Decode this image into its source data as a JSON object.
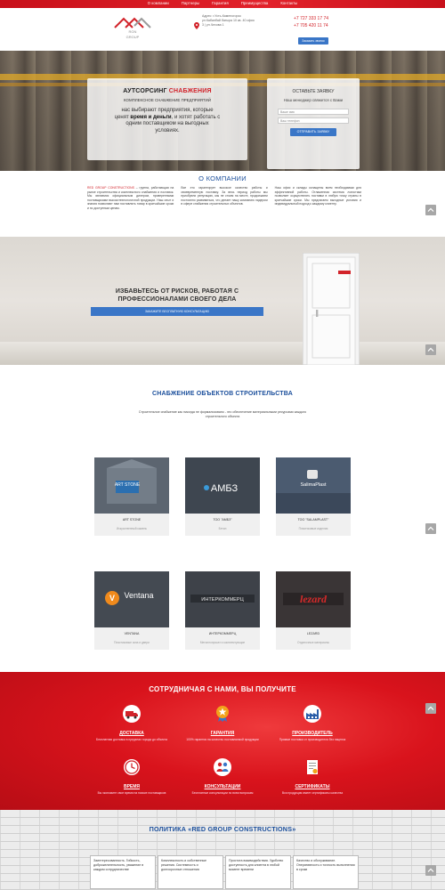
{
  "nav": {
    "items": [
      "О компании",
      "Партнеры",
      "Гарантия",
      "Преимущества",
      "Контакты"
    ]
  },
  "header": {
    "logo_text": "RGN\nGROUP",
    "address": "Адрес: г.Усть-Каменогорск ул.Кабанбай батыра 10 кв. 40 офис 3 | ул.Чехова 1",
    "phones": [
      "+7 727 333 17 74",
      "+7 705 420 11 74"
    ],
    "cta": "Заказать звонок"
  },
  "hero": {
    "title_main": "АУТСОРСИНГ ",
    "title_accent": "СНАБЖЕНИЯ",
    "subtitle": "КОМПЛЕКСНОЕ СНАБЖЕНИЕ ПРЕДПРИЯТИЙ",
    "text_a": "нас выбирают предприятия, которые ценят ",
    "text_b": "время и деньги",
    "text_c": ", и хотят работать с одним поставщиком на выгодных условиях.",
    "form": {
      "title": "ОСТАВЬТЕ ЗАЯВКУ",
      "subtitle": "Наш менеджер свяжется с Вами",
      "name_placeholder": "Ваше имя",
      "phone_placeholder": "Ваш телефон",
      "submit": "ОТПРАВИТЬ ЗАЯВКУ"
    }
  },
  "about": {
    "title": "О КОМПАНИИ",
    "col1_accent": "RED GROUP CONSTRUCTIONS",
    "col1": " – группа, работающая на рынке строительства и комплексного снабжения и поставок. Мы являемся официальным дилером, проверенными поставщиками высокотехнологичной продукции. Наш опыт и знания позволяют нам поставлять товар в кратчайшие сроки и по доступным ценам.",
    "col2": "Все это гарантирует высокое качество работы и своевременную поставку. За весь период работы мы приобрели репутацию, мы не стоим на месте, продолжаем постоянно развиваться, что делает нашу компанию лидером в сфере снабжения строительных объектов.",
    "col3": "Наш офис и склады оснащены всем необходимым для эффективной работы. Отлаженная система логистики позволяет осуществлять поставки в любую точку страны в кратчайшие сроки. Мы предлагаем выгодные условия и индивидуальный подход к каждому клиенту."
  },
  "banner": {
    "title": "ИЗБАВЬТЕСЬ ОТ РИСКОВ, РАБОТАЯ С ПРОФЕССИОНАЛАМИ СВОЕГО ДЕЛА",
    "button": "ЗАКАЖИТЕ БЕСПЛАТНУЮ КОНСУЛЬТАЦИЮ"
  },
  "supply": {
    "title": "СНАБЖЕНИЕ ОБЪЕКТОВ СТРОИТЕЛЬСТВА",
    "description": "Строительное снабжение как никогда не формализовано - это обеспечение материальными ресурсами каждого строительного объекта",
    "cards": [
      {
        "name": "ART STONE",
        "category": "Искусственный камень",
        "logo": "ART STONE"
      },
      {
        "name": "ТОО \"АМБЗ\"",
        "category": "Бетон",
        "logo": "АМБЗ"
      },
      {
        "name": "ТОО \"SALAMPLAST\"",
        "category": "Пластиковые изделия",
        "logo": "SalimaPlast"
      },
      {
        "name": "VENTANA",
        "category": "Пластиковые окна и двери",
        "logo": "Ventana"
      },
      {
        "name": "ИНТЕРКОММЕРЦ",
        "category": "Металлопрокат и комплектующие",
        "logo": "ИНТЕРКОММЕРЦ"
      },
      {
        "name": "LEZARD",
        "category": "Отделочные материалы",
        "logo": "lezard"
      }
    ]
  },
  "coop": {
    "title": "СОТРУДНИЧАЯ С НАМИ, ВЫ ПОЛУЧИТЕ",
    "features": [
      {
        "title": "ДОСТАВКА",
        "desc": "Бесплатная доставка в пределах города до объекта",
        "icon": "truck-icon"
      },
      {
        "title": "ГАРАНТИЯ",
        "desc": "100% гарантия на качество поставляемой продукции",
        "icon": "medal-icon"
      },
      {
        "title": "ПРОИЗВОДИТЕЛЬ",
        "desc": "Прямые поставки от производителя без наценок",
        "icon": "factory-icon"
      },
      {
        "title": "ВРЕМЯ",
        "desc": "Вы экономите свое время на поиске поставщиков",
        "icon": "clock-icon"
      },
      {
        "title": "КОНСУЛЬТАЦИИ",
        "desc": "Бесплатные консультации по всем вопросам",
        "icon": "people-icon"
      },
      {
        "title": "СЕРТИФИКАТЫ",
        "desc": "Вся продукция имеет сертификаты качества",
        "icon": "certificate-icon"
      }
    ]
  },
  "policy": {
    "title": "ПОЛИТИКА «RED GROUP CONSTRUCTIONS»",
    "items": [
      "Заинтересованность. Гибкость, доброжелательность, уважение в каждом сотрудничестве",
      "Комплексность и собственные решения. Системность и долгосрочные отношения",
      "Простота взаимодействия. Удобство доступность для клиента в любой момент времени",
      "Качество и обслуживание. Оперативность и точность выполнения в сроки"
    ]
  }
}
